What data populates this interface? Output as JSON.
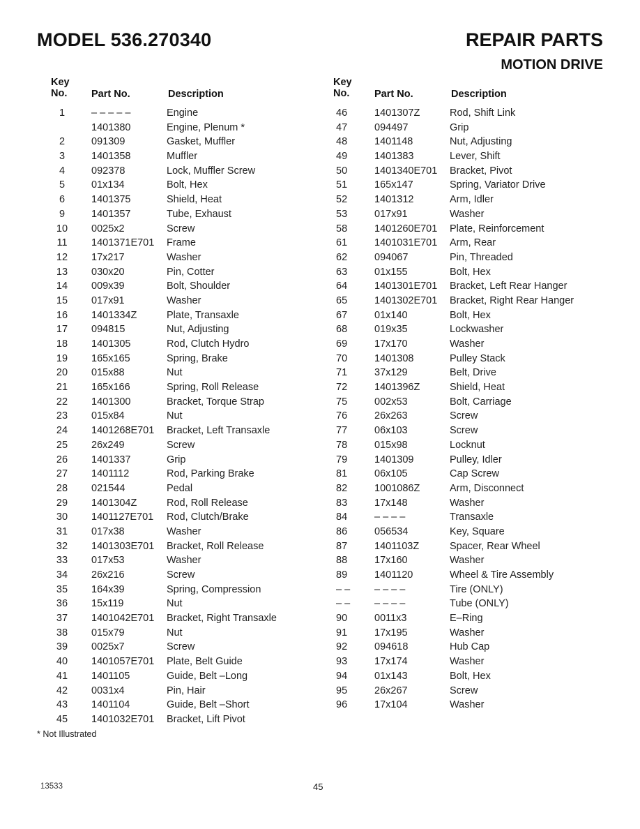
{
  "header": {
    "model": "MODEL 536.270340",
    "title": "REPAIR PARTS",
    "section": "MOTION DRIVE"
  },
  "columns": {
    "key_line1": "Key",
    "key_line2": "No.",
    "part": "Part No.",
    "description": "Description"
  },
  "left_rows": [
    {
      "key": "1",
      "part": "– – – – –",
      "desc": "Engine"
    },
    {
      "key": "",
      "part": "1401380",
      "desc": "Engine, Plenum *"
    },
    {
      "key": "2",
      "part": "091309",
      "desc": "Gasket, Muffler"
    },
    {
      "key": "3",
      "part": "1401358",
      "desc": "Muffler"
    },
    {
      "key": "4",
      "part": "092378",
      "desc": "Lock, Muffler Screw"
    },
    {
      "key": "5",
      "part": "01x134",
      "desc": "Bolt, Hex"
    },
    {
      "key": "6",
      "part": "1401375",
      "desc": "Shield, Heat"
    },
    {
      "key": "9",
      "part": "1401357",
      "desc": "Tube, Exhaust"
    },
    {
      "key": "10",
      "part": "0025x2",
      "desc": "Screw"
    },
    {
      "key": "11",
      "part": "1401371E701",
      "desc": "Frame"
    },
    {
      "key": "12",
      "part": "17x217",
      "desc": "Washer"
    },
    {
      "key": "13",
      "part": "030x20",
      "desc": "Pin, Cotter"
    },
    {
      "key": "14",
      "part": "009x39",
      "desc": "Bolt, Shoulder"
    },
    {
      "key": "15",
      "part": "017x91",
      "desc": "Washer"
    },
    {
      "key": "16",
      "part": "1401334Z",
      "desc": "Plate, Transaxle"
    },
    {
      "key": "17",
      "part": "094815",
      "desc": "Nut, Adjusting"
    },
    {
      "key": "18",
      "part": "1401305",
      "desc": "Rod, Clutch Hydro"
    },
    {
      "key": "19",
      "part": "165x165",
      "desc": "Spring, Brake"
    },
    {
      "key": "20",
      "part": "015x88",
      "desc": "Nut"
    },
    {
      "key": "21",
      "part": "165x166",
      "desc": "Spring, Roll Release"
    },
    {
      "key": "22",
      "part": "1401300",
      "desc": "Bracket, Torque Strap"
    },
    {
      "key": "23",
      "part": "015x84",
      "desc": "Nut"
    },
    {
      "key": "24",
      "part": "1401268E701",
      "desc": "Bracket, Left Transaxle"
    },
    {
      "key": "25",
      "part": "26x249",
      "desc": "Screw"
    },
    {
      "key": "26",
      "part": "1401337",
      "desc": "Grip"
    },
    {
      "key": "27",
      "part": "1401112",
      "desc": "Rod, Parking Brake"
    },
    {
      "key": "28",
      "part": "021544",
      "desc": "Pedal"
    },
    {
      "key": "29",
      "part": "1401304Z",
      "desc": "Rod, Roll Release"
    },
    {
      "key": "30",
      "part": "1401127E701",
      "desc": "Rod, Clutch/Brake"
    },
    {
      "key": "31",
      "part": "017x38",
      "desc": "Washer"
    },
    {
      "key": "32",
      "part": "1401303E701",
      "desc": "Bracket, Roll Release"
    },
    {
      "key": "33",
      "part": "017x53",
      "desc": "Washer"
    },
    {
      "key": "34",
      "part": "26x216",
      "desc": "Screw"
    },
    {
      "key": "35",
      "part": "164x39",
      "desc": "Spring, Compression"
    },
    {
      "key": "36",
      "part": "15x119",
      "desc": "Nut"
    },
    {
      "key": "37",
      "part": "1401042E701",
      "desc": "Bracket, Right Transaxle"
    },
    {
      "key": "38",
      "part": "015x79",
      "desc": "Nut"
    },
    {
      "key": "39",
      "part": "0025x7",
      "desc": "Screw"
    },
    {
      "key": "40",
      "part": "1401057E701",
      "desc": "Plate, Belt Guide"
    },
    {
      "key": "41",
      "part": "1401105",
      "desc": "Guide, Belt –Long"
    },
    {
      "key": "42",
      "part": "0031x4",
      "desc": "Pin, Hair"
    },
    {
      "key": "43",
      "part": "1401104",
      "desc": "Guide, Belt –Short"
    },
    {
      "key": "45",
      "part": "1401032E701",
      "desc": "Bracket, Lift Pivot"
    }
  ],
  "right_rows": [
    {
      "key": "46",
      "part": "1401307Z",
      "desc": "Rod, Shift Link"
    },
    {
      "key": "47",
      "part": "094497",
      "desc": "Grip"
    },
    {
      "key": "48",
      "part": "1401148",
      "desc": "Nut, Adjusting"
    },
    {
      "key": "49",
      "part": "1401383",
      "desc": "Lever, Shift"
    },
    {
      "key": "50",
      "part": "1401340E701",
      "desc": "Bracket, Pivot"
    },
    {
      "key": "51",
      "part": "165x147",
      "desc": "Spring, Variator Drive"
    },
    {
      "key": "52",
      "part": "1401312",
      "desc": "Arm, Idler"
    },
    {
      "key": "53",
      "part": "017x91",
      "desc": "Washer"
    },
    {
      "key": "58",
      "part": "1401260E701",
      "desc": "Plate, Reinforcement"
    },
    {
      "key": "61",
      "part": "1401031E701",
      "desc": "Arm, Rear"
    },
    {
      "key": "62",
      "part": "094067",
      "desc": "Pin, Threaded"
    },
    {
      "key": "63",
      "part": "01x155",
      "desc": "Bolt, Hex"
    },
    {
      "key": "64",
      "part": "1401301E701",
      "desc": "Bracket, Left Rear Hanger"
    },
    {
      "key": "65",
      "part": "1401302E701",
      "desc": "Bracket, Right Rear Hanger"
    },
    {
      "key": "67",
      "part": "01x140",
      "desc": "Bolt, Hex"
    },
    {
      "key": "68",
      "part": "019x35",
      "desc": "Lockwasher"
    },
    {
      "key": "69",
      "part": "17x170",
      "desc": "Washer"
    },
    {
      "key": "70",
      "part": "1401308",
      "desc": "Pulley Stack"
    },
    {
      "key": "71",
      "part": "37x129",
      "desc": "Belt, Drive"
    },
    {
      "key": "72",
      "part": "1401396Z",
      "desc": "Shield, Heat"
    },
    {
      "key": "75",
      "part": "002x53",
      "desc": "Bolt, Carriage"
    },
    {
      "key": "76",
      "part": "26x263",
      "desc": "Screw"
    },
    {
      "key": "77",
      "part": "06x103",
      "desc": "Screw"
    },
    {
      "key": "78",
      "part": "015x98",
      "desc": "Locknut"
    },
    {
      "key": "79",
      "part": "1401309",
      "desc": "Pulley, Idler"
    },
    {
      "key": "81",
      "part": "06x105",
      "desc": "Cap Screw"
    },
    {
      "key": "82",
      "part": "1001086Z",
      "desc": "Arm, Disconnect"
    },
    {
      "key": "83",
      "part": "17x148",
      "desc": "Washer"
    },
    {
      "key": "84",
      "part": "– – – –",
      "desc": "Transaxle"
    },
    {
      "key": "86",
      "part": "056534",
      "desc": "Key, Square"
    },
    {
      "key": "87",
      "part": "1401103Z",
      "desc": "Spacer, Rear Wheel"
    },
    {
      "key": "88",
      "part": "17x160",
      "desc": "Washer"
    },
    {
      "key": "89",
      "part": "1401120",
      "desc": "Wheel & Tire Assembly"
    },
    {
      "key": "– –",
      "part": "– – – –",
      "desc": "Tire (ONLY)"
    },
    {
      "key": "– –",
      "part": "– – – –",
      "desc": "Tube (ONLY)"
    },
    {
      "key": "90",
      "part": "0011x3",
      "desc": "E–Ring"
    },
    {
      "key": "91",
      "part": "17x195",
      "desc": "Washer"
    },
    {
      "key": "92",
      "part": "094618",
      "desc": "Hub Cap"
    },
    {
      "key": "93",
      "part": "17x174",
      "desc": "Washer"
    },
    {
      "key": "94",
      "part": "01x143",
      "desc": "Bolt, Hex"
    },
    {
      "key": "95",
      "part": "26x267",
      "desc": "Screw"
    },
    {
      "key": "96",
      "part": "17x104",
      "desc": "Washer"
    }
  ],
  "footnote": "*  Not Illustrated",
  "footer": {
    "doc_number": "13533",
    "page_number": "45"
  }
}
